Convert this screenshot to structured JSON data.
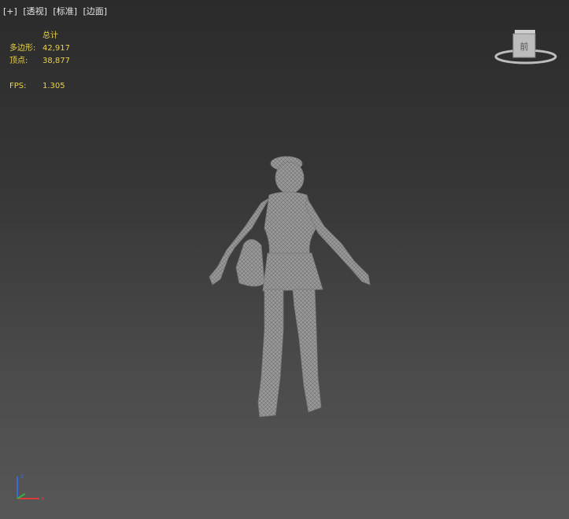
{
  "viewport_menu": {
    "plus": "[+]",
    "view": "[透视]",
    "shading": "[标准]",
    "edges": "[边面]"
  },
  "stats": {
    "header": "总计",
    "polygons_label": "多边形:",
    "polygons_value": "42,917",
    "vertices_label": "顶点:",
    "vertices_value": "38,877",
    "fps_label": "FPS:",
    "fps_value": "1.305"
  },
  "viewcube": {
    "face_label": "前"
  },
  "axis_gizmo": {
    "z": "z",
    "x": "x"
  },
  "colors": {
    "stats_text": "#e9d24a",
    "mesh": "#9a9a9a",
    "axis_x": "#d83a3a",
    "axis_y": "#3ab03a",
    "axis_z": "#3a6ad8"
  }
}
